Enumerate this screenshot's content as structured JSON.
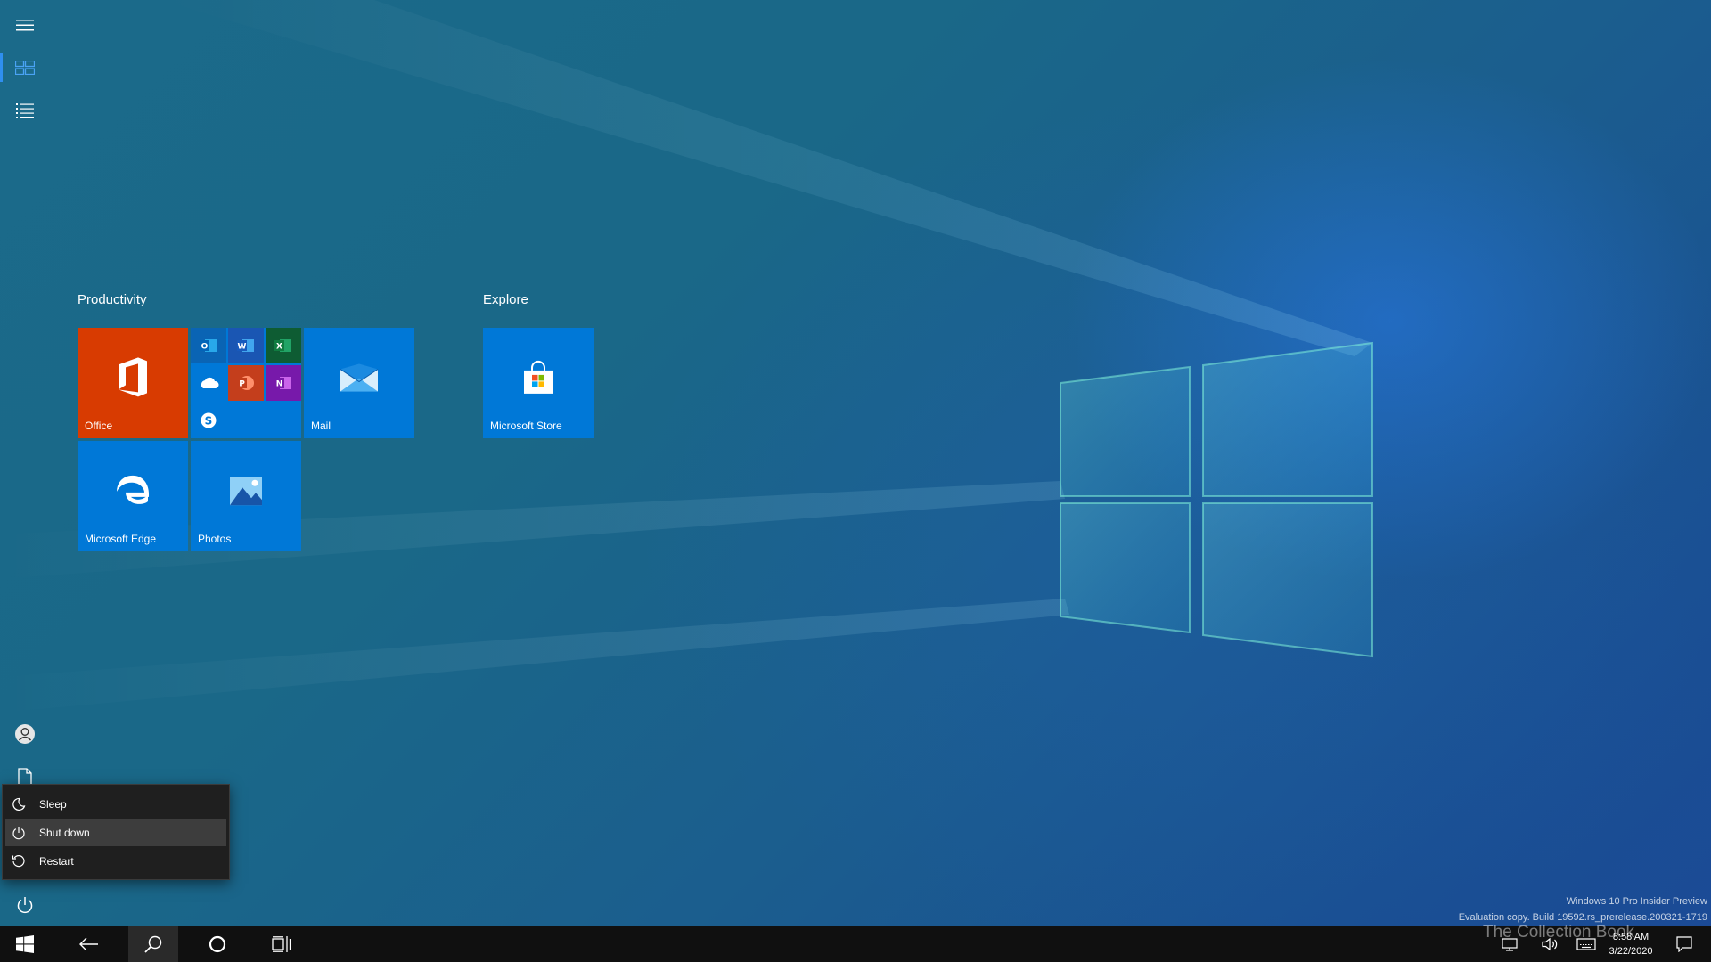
{
  "groups": [
    {
      "title": "Productivity"
    },
    {
      "title": "Explore"
    }
  ],
  "tiles": {
    "office": {
      "label": "Office",
      "color": "#d83b01"
    },
    "mail": {
      "label": "Mail",
      "color": "#0078d7"
    },
    "edge": {
      "label": "Microsoft Edge",
      "color": "#0078d7"
    },
    "photos": {
      "label": "Photos",
      "color": "#0078d7"
    },
    "store": {
      "label": "Microsoft Store",
      "color": "#0078d7"
    },
    "office_apps_folder": {
      "color": "#0078d7",
      "apps": [
        {
          "icon": "outlook-icon",
          "letter": "O",
          "color": "#0a64b4"
        },
        {
          "icon": "word-icon",
          "letter": "W",
          "color": "#1a56b3"
        },
        {
          "icon": "excel-icon",
          "letter": "X",
          "color": "#107c41"
        },
        {
          "icon": "onedrive-icon",
          "letter": "",
          "color": "#0078d7"
        },
        {
          "icon": "powerpoint-icon",
          "letter": "P",
          "color": "#c43e1c"
        },
        {
          "icon": "onenote-icon",
          "letter": "N",
          "color": "#7719aa"
        },
        {
          "icon": "skype-icon",
          "letter": "S",
          "color": "#0078d7"
        }
      ]
    }
  },
  "power_menu": {
    "items": [
      {
        "label": "Sleep",
        "icon": "moon-icon"
      },
      {
        "label": "Shut down",
        "icon": "power-icon"
      },
      {
        "label": "Restart",
        "icon": "restart-icon"
      }
    ]
  },
  "rail": {
    "icons": [
      "hamburger-icon",
      "tiles-icon",
      "all-apps-list-icon",
      "user-account-icon",
      "documents-icon",
      "power-icon"
    ]
  },
  "taskbar": {
    "icons": [
      "start-icon",
      "back-icon",
      "search-icon",
      "cortana-icon",
      "task-view-icon"
    ],
    "tray_icons": [
      "network-icon",
      "volume-icon",
      "keyboard-icon",
      "notification-icon"
    ],
    "time": "8:58 AM",
    "date": "3/22/2020"
  },
  "watermark": {
    "line1": "Windows 10 Pro Insider Preview",
    "line2": "Evaluation copy. Build 19592.rs_prerelease.200321-1719"
  },
  "brand": {
    "text": "The Collection Book"
  }
}
